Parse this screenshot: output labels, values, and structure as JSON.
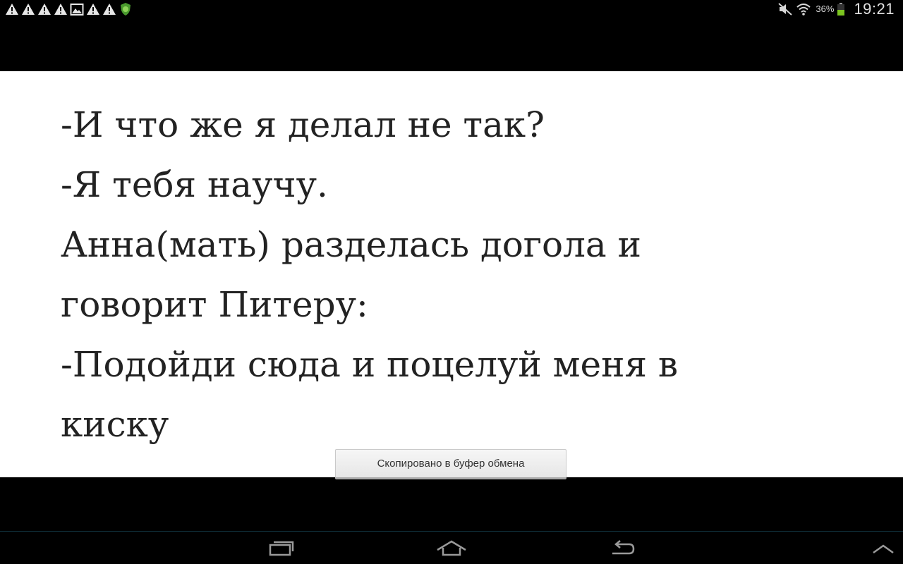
{
  "status_bar": {
    "notification_icons": [
      "warning-icon",
      "warning-icon",
      "warning-icon",
      "warning-icon",
      "gallery-icon",
      "warning-icon",
      "warning-icon",
      "app-shield-icon"
    ],
    "battery_percent": "36%",
    "time": "19:21",
    "battery_color": "#7cc520"
  },
  "content": {
    "lines": [
      "-И что же я делал не так?",
      "-Я тебя научу.",
      "Анна(мать) разделась догола и",
      "говорит Питеру:",
      "-Подойди сюда и поцелуй меня в",
      "киску"
    ]
  },
  "toast": {
    "message": "Скопировано в буфер обмена"
  },
  "navigation": {
    "buttons": [
      "recent-apps-icon",
      "home-icon",
      "back-icon",
      "menu-up-icon"
    ]
  }
}
